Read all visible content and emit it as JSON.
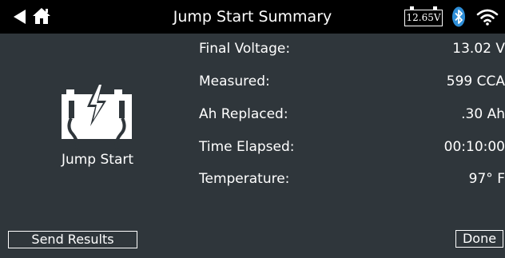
{
  "header": {
    "title": "Jump Start Summary",
    "battery_voltage": "12.65V",
    "icons": [
      "back-arrow-icon",
      "home-icon",
      "battery-icon",
      "bluetooth-icon",
      "wifi-icon"
    ]
  },
  "panel": {
    "icon": "jump-start-icon",
    "label": "Jump Start"
  },
  "results": [
    {
      "label": "Final Voltage:",
      "value": "13.02 V"
    },
    {
      "label": "Measured:",
      "value": "599 CCA"
    },
    {
      "label": "Ah Replaced:",
      "value": ".30 Ah"
    },
    {
      "label": "Time Elapsed:",
      "value": "00:10:00"
    },
    {
      "label": "Temperature:",
      "value": "97° F"
    }
  ],
  "footer": {
    "send_label": "Send Results",
    "done_label": "Done"
  },
  "colors": {
    "background": "#2f363b",
    "header": "#000000",
    "text": "#ffffff"
  }
}
